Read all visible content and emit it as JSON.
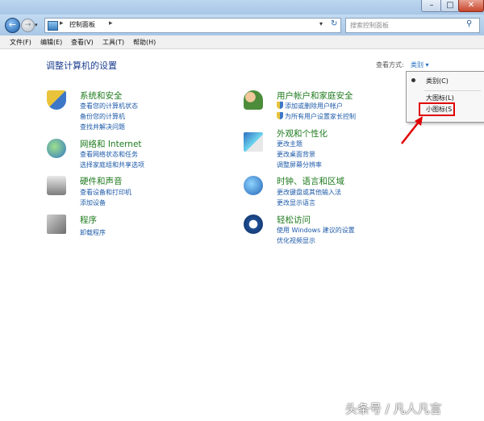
{
  "titlebar": {
    "min_symbol": "–",
    "max_symbol": "□",
    "close_symbol": "✕"
  },
  "nav": {
    "back_symbol": "←",
    "forward_symbol": "→",
    "address": {
      "breadcrumb": "控制面板",
      "separator": "▸",
      "dropdown_symbol": "▾",
      "refresh_symbol": "↻"
    },
    "search": {
      "placeholder": "搜索控制面板",
      "icon_symbol": "⚲"
    }
  },
  "menu": [
    {
      "label": "文件(F)"
    },
    {
      "label": "编辑(E)"
    },
    {
      "label": "查看(V)"
    },
    {
      "label": "工具(T)"
    },
    {
      "label": "帮助(H)"
    }
  ],
  "page": {
    "title": "调整计算机的设置",
    "view_by_label": "查看方式:",
    "view_by_value": "类别 ▾"
  },
  "categories": [
    {
      "title": "系统和安全",
      "links": [
        "查看您的计算机状态",
        "备份您的计算机",
        "查找并解决问题"
      ],
      "icon": "system-security-icon"
    },
    {
      "title": "网络和 Internet",
      "links": [
        "查看网络状态和任务",
        "选择家庭组和共享选项"
      ],
      "icon": "network-icon"
    },
    {
      "title": "硬件和声音",
      "links": [
        "查看设备和打印机",
        "添加设备"
      ],
      "icon": "hardware-sound-icon"
    },
    {
      "title": "程序",
      "links": [
        "卸载程序"
      ],
      "icon": "programs-icon"
    },
    {
      "title": "用户帐户和家庭安全",
      "links": [
        "添加或删除用户帐户",
        "为所有用户设置家长控制"
      ],
      "icon": "user-accounts-icon"
    },
    {
      "title": "外观和个性化",
      "links": [
        "更改主题",
        "更改桌面背景",
        "调整屏幕分辨率"
      ],
      "icon": "appearance-icon"
    },
    {
      "title": "时钟、语言和区域",
      "links": [
        "更改键盘或其他输入法",
        "更改显示语言"
      ],
      "icon": "clock-region-icon"
    },
    {
      "title": "轻松访问",
      "links": [
        "使用 Windows 建议的设置",
        "优化视频显示"
      ],
      "icon": "ease-of-access-icon"
    }
  ],
  "dropdown": {
    "options": [
      "类别(C)",
      "大图标(L)",
      "小图标(S"
    ],
    "selected": "类别(C)"
  },
  "watermark": "头条号 / 凡人凡言"
}
